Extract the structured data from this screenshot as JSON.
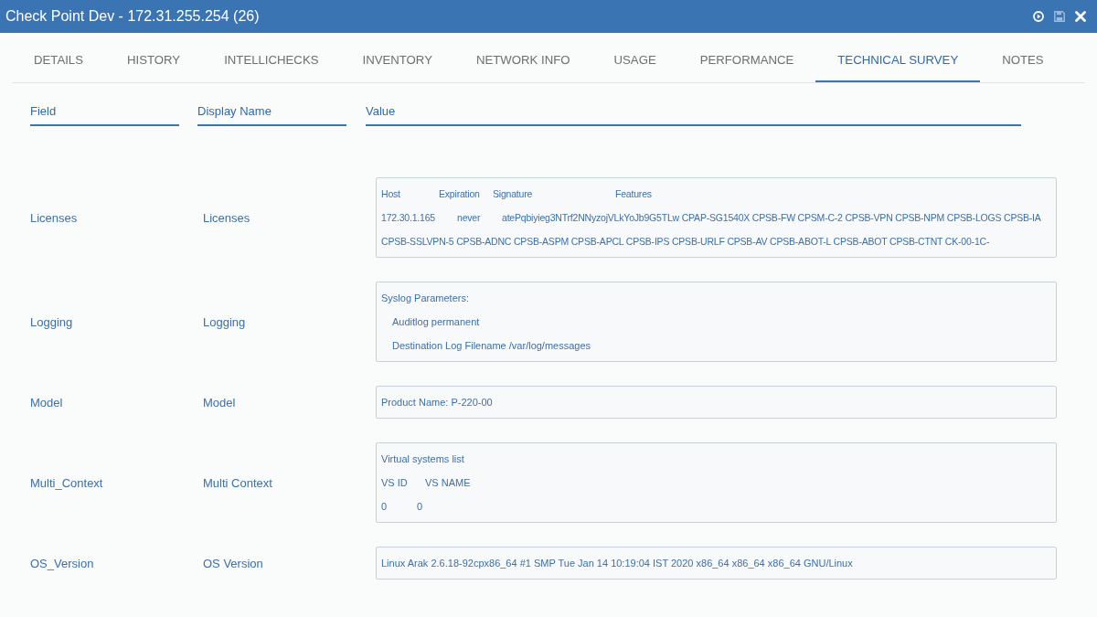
{
  "window": {
    "title": "Check Point Dev - 172.31.255.254 (26)",
    "buttons": [
      {
        "kind": "play",
        "disabled": false
      },
      {
        "kind": "save",
        "disabled": true
      },
      {
        "kind": "close",
        "disabled": false
      }
    ]
  },
  "tabs": [
    {
      "label": "DETAILS",
      "selected": false
    },
    {
      "label": "HISTORY",
      "selected": false
    },
    {
      "label": "INTELLICHECKS",
      "selected": false
    },
    {
      "label": "INVENTORY",
      "selected": false
    },
    {
      "label": "NETWORK INFO",
      "selected": false
    },
    {
      "label": "USAGE",
      "selected": false
    },
    {
      "label": "PERFORMANCE",
      "selected": false
    },
    {
      "label": "TECHNICAL SURVEY",
      "selected": true
    },
    {
      "label": "NOTES",
      "selected": false
    }
  ],
  "columns": [
    "Field",
    "Display Name",
    "Value"
  ],
  "rows": [
    {
      "field": "Licenses",
      "display_name": "Licenses",
      "value": {
        "kind": "license_table",
        "columns": [
          "Host",
          "Expiration",
          "Signature",
          "Features"
        ],
        "rows": [
          {
            "host": "172.30.1.165",
            "expiration": "never",
            "signature": "atePqbiyieg3NTrf2NNyzojVLkYoJb9G5TLw",
            "features": [
              "CPAP-SG1540X",
              "CPSB-FW",
              "CPSM-C-2",
              "CPSB-VPN",
              "CPSB-NPM",
              "CPSB-LOGS",
              "CPSB-IA",
              "CPSB-SSLVPN-5",
              "CPSB-ADNC",
              "CPSB-ASPM",
              "CPSB-APCL",
              "CPSB-IPS",
              "CPSB-URLF",
              "CPSB-AV",
              "CPSB-ABOT-L",
              "CPSB-ABOT",
              "CPSB-CTNT",
              "CK-00-1C-"
            ]
          }
        ]
      }
    },
    {
      "field": "Logging",
      "display_name": "Logging",
      "value": {
        "kind": "parameters",
        "heading": "Syslog Parameters:",
        "items": [
          "Auditlog permanent",
          "Destination Log Filename /var/log/messages"
        ]
      }
    },
    {
      "field": "Model",
      "display_name": "Model",
      "value": {
        "kind": "text",
        "text": "Product Name: P-220-00"
      }
    },
    {
      "field": "Multi_Context",
      "display_name": "Multi Context",
      "value": {
        "kind": "vs_table",
        "heading": "Virtual systems list",
        "columns": [
          "VS ID",
          "VS NAME"
        ],
        "rows": [
          [
            "0",
            "0"
          ]
        ]
      }
    },
    {
      "field": "OS_Version",
      "display_name": "OS Version",
      "value": {
        "kind": "text",
        "text": "Linux Arak 2.6.18-92cpx86_64 #1 SMP Tue Jan 14 10:19:04 IST 2020 x86_64 x86_64 x86_64 GNU/Linux"
      }
    }
  ]
}
